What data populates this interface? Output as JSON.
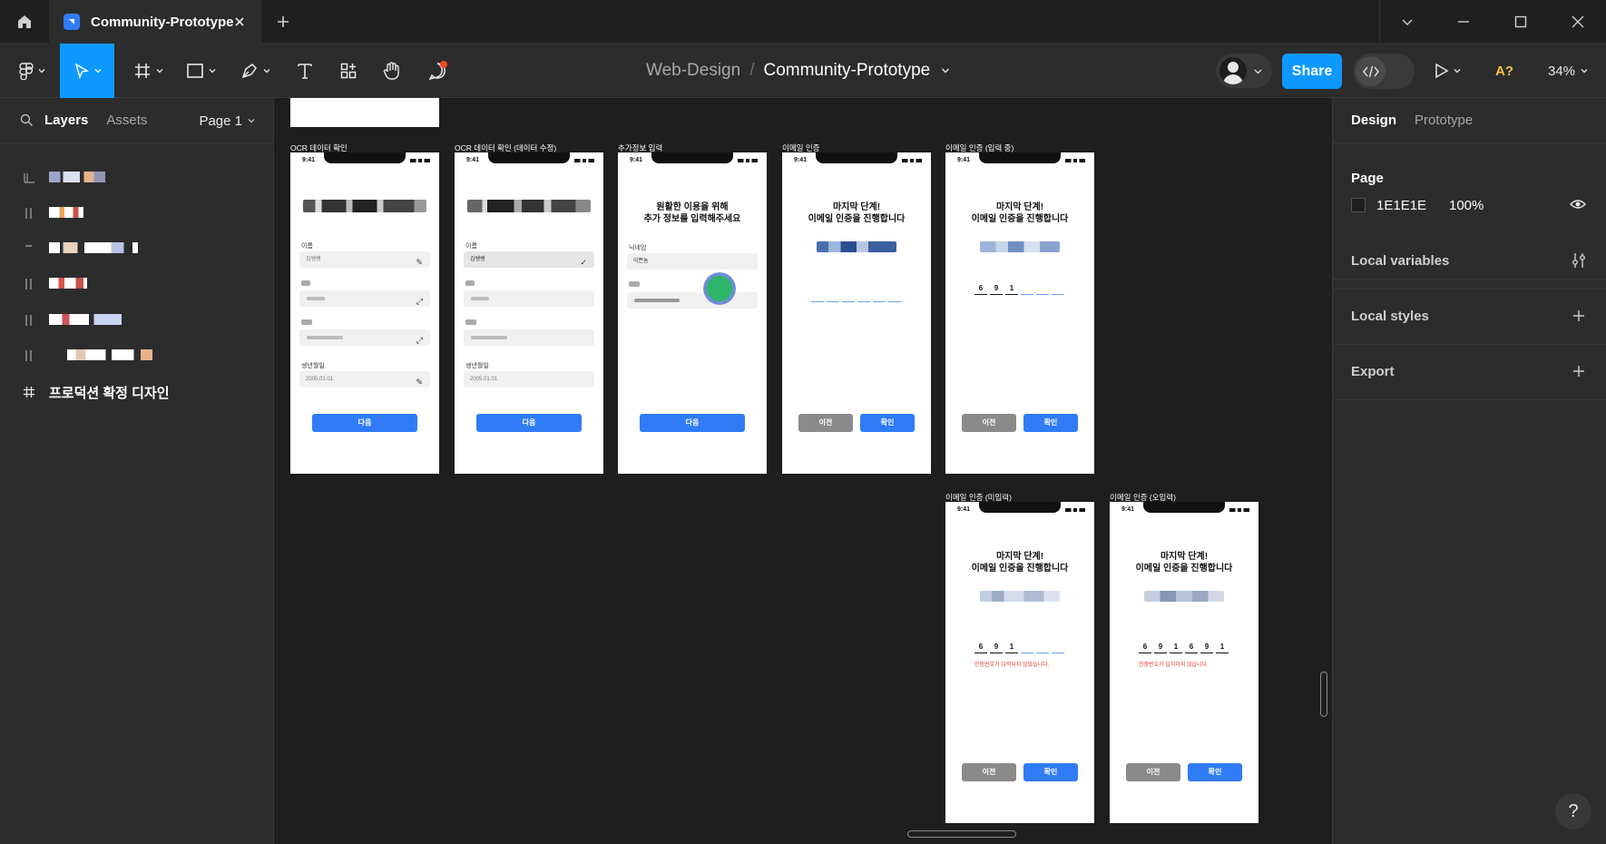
{
  "window": {
    "tab_title": "Community-Prototype",
    "home_icon": "home-icon",
    "close_icon": "close-icon",
    "new_tab_icon": "plus-icon"
  },
  "toolbar": {
    "project": "Web-Design",
    "separator": "/",
    "file_name": "Community-Prototype",
    "share_label": "Share",
    "font_warning": "A?",
    "zoom": "34%"
  },
  "left_panel": {
    "tabs": [
      "Layers",
      "Assets"
    ],
    "page_selector": "Page 1",
    "layers": [
      {
        "icon": "component-icon",
        "name": ""
      },
      {
        "icon": "frame-icon",
        "name": ""
      },
      {
        "icon": "text-icon",
        "name": ""
      },
      {
        "icon": "frame-icon",
        "name": ""
      },
      {
        "icon": "frame-icon",
        "name": ""
      },
      {
        "icon": "frame-icon",
        "name": ""
      },
      {
        "icon": "hash-icon",
        "name": "프로덕션 확정 디자인"
      }
    ]
  },
  "canvas": {
    "frames": [
      {
        "label": "OCR 데이터 확인",
        "time": "9:41",
        "button": "다음",
        "field1_label": "이름",
        "field1_value": "김쌩쌩",
        "field2_label": "생년월일",
        "field2_value": "2005.01.01"
      },
      {
        "label": "OCR 데이터 확인 (데이터 수정)",
        "time": "9:41",
        "button": "다음",
        "field1_label": "이름",
        "field1_value": "김쌩쌩",
        "field2_label": "생년월일",
        "field2_value": "2005.01.01"
      },
      {
        "label": "추가정보 입력",
        "time": "9:41",
        "title_line1": "원활한 이용을 위해",
        "title_line2": "추가 정보를 입력해주세요",
        "field1_label": "닉네임",
        "field1_value": "이쁜놈",
        "button": "다음"
      },
      {
        "label": "이메일 인증",
        "time": "9:41",
        "title_line1": "마지막 단계!",
        "title_line2": "이메일 인증을 진행합니다",
        "prev": "이전",
        "confirm": "확인"
      },
      {
        "label": "이메일 인증 (입력 중)",
        "time": "9:41",
        "title_line1": "마지막 단계!",
        "title_line2": "이메일 인증을 진행합니다",
        "code": [
          "6",
          "9",
          "1",
          "",
          "",
          ""
        ],
        "prev": "이전",
        "confirm": "확인"
      },
      {
        "label": "이메일 인증 (미입력)",
        "time": "9:41",
        "title_line1": "마지막 단계!",
        "title_line2": "이메일 인증을 진행합니다",
        "code": [
          "6",
          "9",
          "1",
          "",
          "",
          ""
        ],
        "error": "인증번호가 입력되지 않았습니다.",
        "prev": "이전",
        "confirm": "확인"
      },
      {
        "label": "이메일 인증 (오입력)",
        "time": "9:41",
        "title_line1": "마지막 단계!",
        "title_line2": "이메일 인증을 진행합니다",
        "code": [
          "6",
          "9",
          "1",
          "6",
          "9",
          "1"
        ],
        "error": "인증번호가 일치하지 않습니다.",
        "prev": "이전",
        "confirm": "확인"
      }
    ]
  },
  "right_panel": {
    "tabs": [
      "Design",
      "Prototype"
    ],
    "page_section": "Page",
    "page_color": "1E1E1E",
    "page_opacity": "100%",
    "local_variables": "Local variables",
    "local_styles": "Local styles",
    "export": "Export",
    "help": "?"
  },
  "colors": {
    "accent": "#0d99ff",
    "canvas_bg": "#1e1e1e",
    "panel_bg": "#2c2c2c",
    "phone_button": "#2f7cf6",
    "error": "#e53935"
  }
}
